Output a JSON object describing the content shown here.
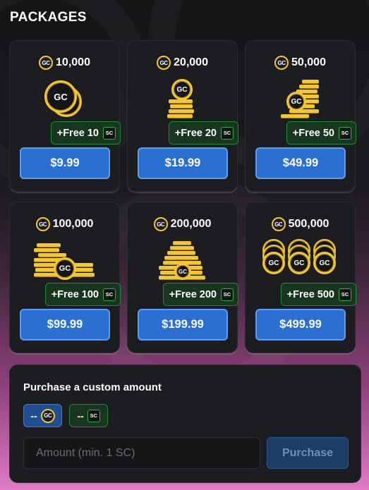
{
  "page_title": "PACKAGES",
  "currency": {
    "gc_icon_label": "GC",
    "sc_icon_label": "SC"
  },
  "packages": [
    {
      "amount": "10,000",
      "bonus": "+Free 10",
      "price": "$9.99",
      "art": "coin-pair-icon"
    },
    {
      "amount": "20,000",
      "bonus": "+Free 20",
      "price": "$19.99",
      "art": "coin-stack-small-icon"
    },
    {
      "amount": "50,000",
      "bonus": "+Free 50",
      "price": "$49.99",
      "art": "coin-stack-medium-icon"
    },
    {
      "amount": "100,000",
      "bonus": "+Free 100",
      "price": "$99.99",
      "art": "coin-bars-icon"
    },
    {
      "amount": "200,000",
      "bonus": "+Free 200",
      "price": "$199.99",
      "art": "coin-pyramid-icon"
    },
    {
      "amount": "500,000",
      "bonus": "+Free 500",
      "price": "$499.99",
      "art": "coin-rolls-icon"
    }
  ],
  "custom": {
    "title": "Purchase a custom amount",
    "gc_toggle_value": "--",
    "sc_toggle_value": "--",
    "amount_placeholder": "Amount (min. 1 SC)",
    "purchase_label": "Purchase"
  },
  "colors": {
    "gold": "#f2c635",
    "button_blue": "#2a6fd1",
    "bonus_green": "#1f8a3a",
    "card_bg": "#1c1d20"
  }
}
